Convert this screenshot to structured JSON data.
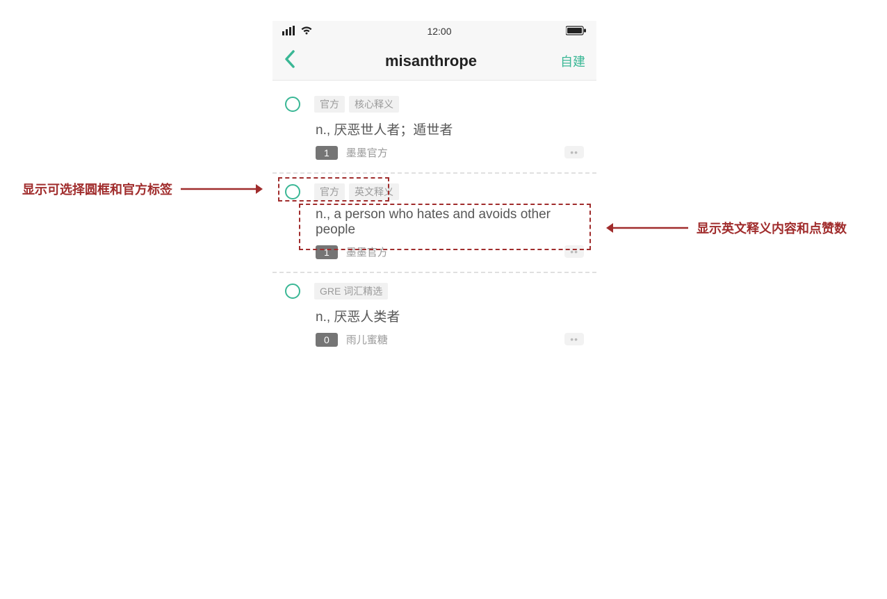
{
  "statusbar": {
    "time": "12:00"
  },
  "nav": {
    "title": "misanthrope",
    "action_label": "自建"
  },
  "cards": [
    {
      "tags": [
        "官方",
        "核心释义"
      ],
      "definition": "n., 厌恶世人者；遁世者",
      "count": "1",
      "author": "墨墨官方"
    },
    {
      "tags": [
        "官方",
        "英文释义"
      ],
      "definition": "n., a person who hates and avoids other people",
      "count": "1",
      "author": "墨墨官方"
    },
    {
      "tags": [
        "GRE 词汇精选"
      ],
      "definition": "n., 厌恶人类者",
      "count": "0",
      "author": "雨儿蜜糖"
    }
  ],
  "annotations": {
    "left": "显示可选择圆框和官方标签",
    "right": "显示英文释义内容和点赞数"
  },
  "colors": {
    "accent": "#3ab795",
    "annotation": "#a02c2c"
  }
}
